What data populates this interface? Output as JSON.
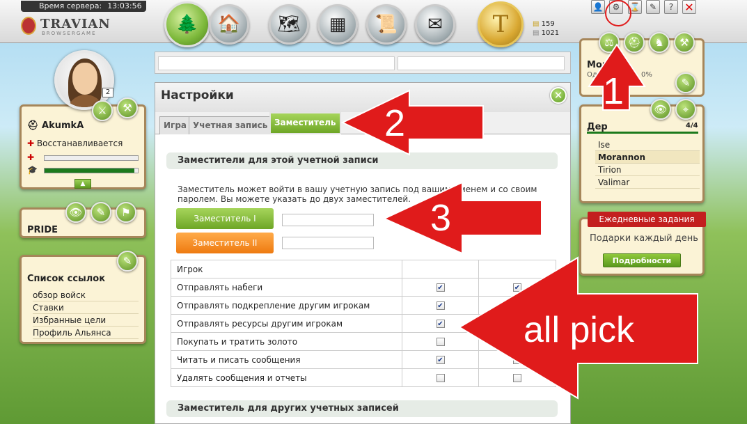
{
  "topbar": {
    "server_time_label": "Время сервера:",
    "server_time_value": "13:03:56",
    "logo_title": "TRAVIAN",
    "logo_sub": "BROWSERGAME",
    "gold_symbol": "T",
    "resources": {
      "coins": "159",
      "silver": "1021"
    },
    "nav_icons": [
      "village-map-icon",
      "village-center-icon",
      "world-map-icon",
      "statistics-icon",
      "reports-icon",
      "messages-icon"
    ],
    "tool_buttons": [
      {
        "name": "profile-icon",
        "glyph": "👤"
      },
      {
        "name": "settings-gears-icon",
        "glyph": "⚙"
      },
      {
        "name": "hourglass-icon",
        "glyph": "⌛"
      },
      {
        "name": "forum-icon",
        "glyph": "✎"
      },
      {
        "name": "help-icon",
        "glyph": "?"
      },
      {
        "name": "logout-icon",
        "glyph": "✕"
      }
    ]
  },
  "hero": {
    "level": "2",
    "name": "AkumkA",
    "status": "Восстанавливается",
    "health_fraction": 0.0,
    "xp_fraction": 0.96
  },
  "alliance": {
    "name": "PRIDE"
  },
  "links": {
    "title": "Список ссылок",
    "items": [
      "обзор войск",
      "Ставки",
      "Избранные цели",
      "Профиль Альянса"
    ]
  },
  "right": {
    "village_title": "Мога",
    "village_sub": "Одоб...",
    "village_percent": "0%",
    "villages_title": "Дер",
    "villages_count": "4/4",
    "villages": [
      "Ise",
      "Morannon",
      "Tirion",
      "Valimar"
    ],
    "daily_title": "Ежедневные задания",
    "daily_text": "Подарки каждый день",
    "daily_button": "Подробности"
  },
  "main": {
    "title": "Настройки",
    "tabs": [
      "Игра",
      "Учетная запись",
      "Заместитель"
    ],
    "section1": "Заместители для этой учетной записи",
    "description": "Заместитель может войти в вашу учетную запись под вашим именем и со своим паролем. Вы можете указать до двух заместителей.",
    "sub1": {
      "label": "Заместитель I",
      "value": ""
    },
    "sub2": {
      "label": "Заместитель II",
      "value": ""
    },
    "perm_header": "Игрок",
    "permissions": [
      {
        "label": "Отправлять набеги",
        "sub1": true,
        "sub2": true
      },
      {
        "label": "Отправлять подкрепление другим игрокам",
        "sub1": true,
        "sub2": false
      },
      {
        "label": "Отправлять ресурсы другим игрокам",
        "sub1": true,
        "sub2": false
      },
      {
        "label": "Покупать и тратить золото",
        "sub1": false,
        "sub2": false
      },
      {
        "label": "Читать и писать сообщения",
        "sub1": true,
        "sub2": false
      },
      {
        "label": "Удалять сообщения и отчеты",
        "sub1": false,
        "sub2": false
      }
    ],
    "section2": "Заместитель для других учетных записей"
  },
  "annotations": {
    "n1": "1",
    "n2": "2",
    "n3": "3",
    "all_pick": "all pick",
    "color": "#e01b1b"
  }
}
